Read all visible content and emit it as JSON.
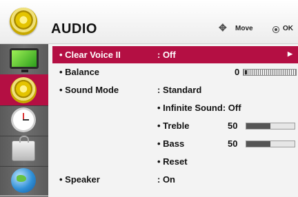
{
  "header": {
    "title": "AUDIO",
    "move_label": "Move",
    "ok_label": "OK",
    "icons": {
      "title_icon": "speaker-icon",
      "move_icon": "four-way-arrow-icon",
      "ok_icon": "ok-button-icon"
    }
  },
  "sidebar": {
    "items": [
      {
        "name": "picture",
        "icon": "tv-icon",
        "active": false
      },
      {
        "name": "audio",
        "icon": "speaker-icon",
        "active": true
      },
      {
        "name": "time",
        "icon": "clock-icon",
        "active": false
      },
      {
        "name": "lock",
        "icon": "lock-icon",
        "active": false
      },
      {
        "name": "network",
        "icon": "globe-icon",
        "active": false
      }
    ],
    "active_color": "#b40f43"
  },
  "menu": {
    "clear_voice": {
      "label": "• Clear Voice II",
      "value": ": Off"
    },
    "balance": {
      "label": "• Balance",
      "number": "0",
      "level_fraction": 0.0
    },
    "sound_mode": {
      "label": "• Sound Mode",
      "value": ": Standard"
    },
    "infinite_sound": {
      "label": "• Infinite Sound: Off"
    },
    "treble": {
      "label": "• Treble",
      "number": "50",
      "level_percent": 50
    },
    "bass": {
      "label": "• Bass",
      "number": "50",
      "level_percent": 50
    },
    "reset": {
      "label": "• Reset"
    },
    "speaker": {
      "label": "• Speaker",
      "value": ": On"
    }
  },
  "colors": {
    "highlight": "#b40f43",
    "bar_fill": "#555555"
  }
}
